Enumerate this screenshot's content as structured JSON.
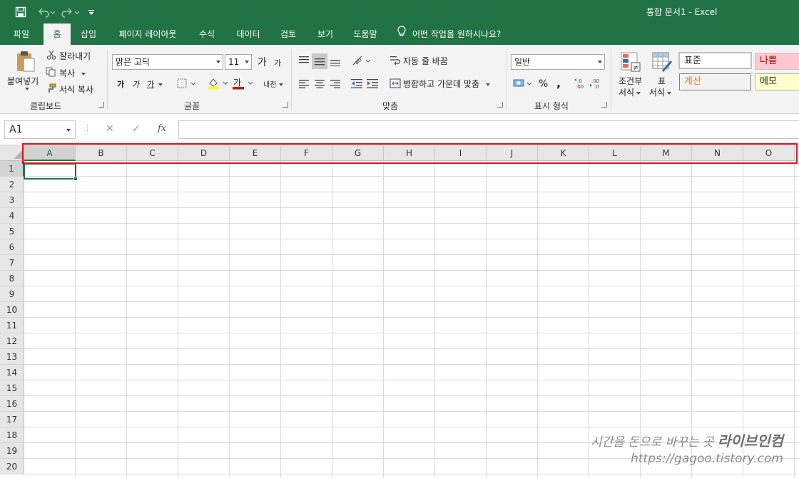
{
  "window": {
    "title": "통합 문서1  -  Excel"
  },
  "quick_access": {
    "save_icon": "save-icon",
    "undo_icon": "undo-icon",
    "redo_icon": "redo-icon",
    "customize_icon": "customize-qat-icon"
  },
  "tabs": [
    {
      "label": "파일"
    },
    {
      "label": "홈",
      "active": true
    },
    {
      "label": "삽입"
    },
    {
      "label": "페이지 레이아웃"
    },
    {
      "label": "수식"
    },
    {
      "label": "데이터"
    },
    {
      "label": "검토"
    },
    {
      "label": "보기"
    },
    {
      "label": "도움말"
    }
  ],
  "tell_me": {
    "label": "어떤 작업을 원하시나요?",
    "icon": "lightbulb-icon"
  },
  "ribbon": {
    "clipboard": {
      "label": "클립보드",
      "paste": "붙여넣기",
      "cut": "잘라내기",
      "copy": "복사",
      "format_painter": "서식 복사"
    },
    "font": {
      "label": "글꼴",
      "font_name": "맑은 고딕",
      "font_size": "11",
      "grow": "가",
      "shrink": "가",
      "bold": "가",
      "italic": "가",
      "underline": "가",
      "font_color_glyph": "가",
      "phonetic": "내천"
    },
    "alignment": {
      "label": "맞춤",
      "wrap_text": "자동 줄 바꿈",
      "merge_center": "병합하고 가운데 맞춤"
    },
    "number": {
      "label": "표시 형식",
      "format": "일반",
      "percent": "%",
      "comma": ","
    },
    "styles": {
      "conditional": [
        "조건부",
        "서식"
      ],
      "table": [
        "표",
        "서식"
      ],
      "cells": [
        {
          "label": "표준",
          "bg": "#ffffff",
          "color": "#222222"
        },
        {
          "label": "나쁨",
          "bg": "#ffc7ce",
          "color": "#9c0006"
        },
        {
          "label": "계산",
          "bg": "#f2f2f2",
          "color": "#fa7d00"
        },
        {
          "label": "메모",
          "bg": "#ffffcc",
          "color": "#222222"
        }
      ]
    }
  },
  "formula_bar": {
    "name_box": "A1",
    "cancel": "✕",
    "enter": "✓",
    "fx": "fx",
    "value": ""
  },
  "sheet": {
    "columns": [
      "A",
      "B",
      "C",
      "D",
      "E",
      "F",
      "G",
      "H",
      "I",
      "J",
      "K",
      "L",
      "M",
      "N",
      "O"
    ],
    "rows": [
      "1",
      "2",
      "3",
      "4",
      "5",
      "6",
      "7",
      "8",
      "9",
      "10",
      "11",
      "12",
      "13",
      "14",
      "15",
      "16",
      "17",
      "18",
      "19",
      "20"
    ],
    "active_cell": "A1"
  },
  "watermark": {
    "line1": "시간을 돈으로 바꾸는 곳",
    "brand": "라이브인컴",
    "line2": "https://gagoo.tistory.com"
  },
  "colors": {
    "accent": "#217346",
    "highlight": "#e0141e"
  }
}
